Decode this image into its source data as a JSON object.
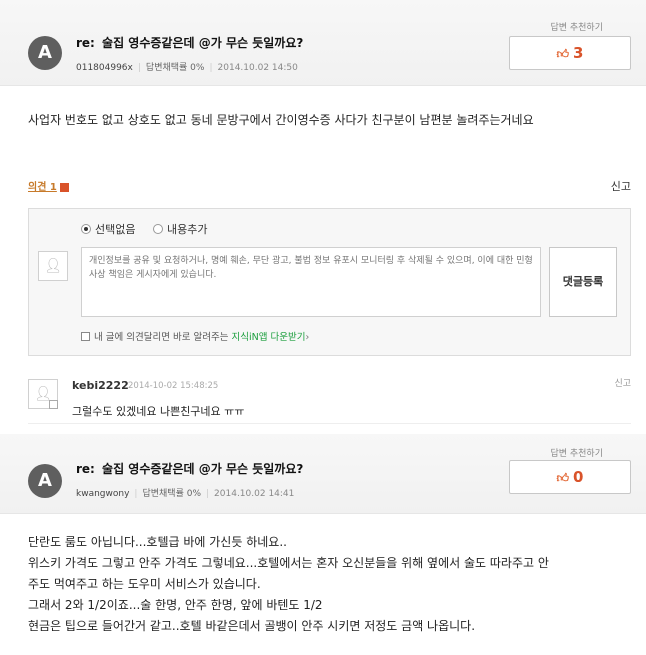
{
  "answers": [
    {
      "recommend_label": "답변 추천하기",
      "recommend_count": "3",
      "avatar_letter": "A",
      "re_prefix": "re:",
      "title": "술집 영수증같은데 @가 무슨 듯일까요?",
      "user": "011804996x",
      "adoption_rate": "답변채택률 0%",
      "date": "2014.10.02 14:50",
      "body": [
        "사업자 번호도 없고 상호도 없고 동네 문방구에서 간이영수증 사다가 친구분이 남편분 놀려주는거네요"
      ]
    },
    {
      "recommend_label": "답변 추천하기",
      "recommend_count": "0",
      "avatar_letter": "A",
      "re_prefix": "re:",
      "title": "술집 영수증같은데 @가 무슨 듯일까요?",
      "user": "kwangwony",
      "adoption_rate": "답변채택률 0%",
      "date": "2014.10.02 14:41",
      "body": [
        "단란도 룸도 아닙니다...호텔급 바에 가신듯 하네요..",
        "위스키 가격도 그렇고 안주 가격도 그렇네요...호텔에서는 혼자 오신분들을 위해 옆에서 술도 따라주고 안",
        "주도 먹여주고 하는  도우미 서비스가 있습니다.",
        "그래서 2와 1/2이죠...술 한명, 안주 한명, 앞에 바텐도 1/2",
        "현금은 팁으로 들어간거 같고..호텔 바같은데서 골뱅이 안주 시키면 저정도 금액 나옵니다."
      ]
    }
  ],
  "opinion": {
    "link_label": "의견 1",
    "report_label": "신고",
    "radio_selected": "선택없음",
    "radio_add": "내용추가",
    "textarea_placeholder": "개인정보를 공유 및 요청하거나, 명예 훼손, 무단 광고, 불법 정보 유포시 모니터링 후 삭제될 수 있으며, 이에 대한 민형사상 책임은 게시자에게 있습니다.",
    "submit_label": "댓글등록",
    "notify_text": "내 글에 의견달리면 바로 알려주는",
    "notify_link": "지식iN앱 다운받기",
    "notify_arrow": "›"
  },
  "reply": {
    "user": "kebi2222",
    "date": "2014-10-02 15:48:25",
    "text": "그럴수도 있겠네요 나쁜친구네요 ㅠㅠ",
    "report_label": "신고"
  },
  "colors": {
    "recommend": "#d9532a",
    "opinion_link": "#c77a2a",
    "notify_link": "#1a9e3c"
  }
}
